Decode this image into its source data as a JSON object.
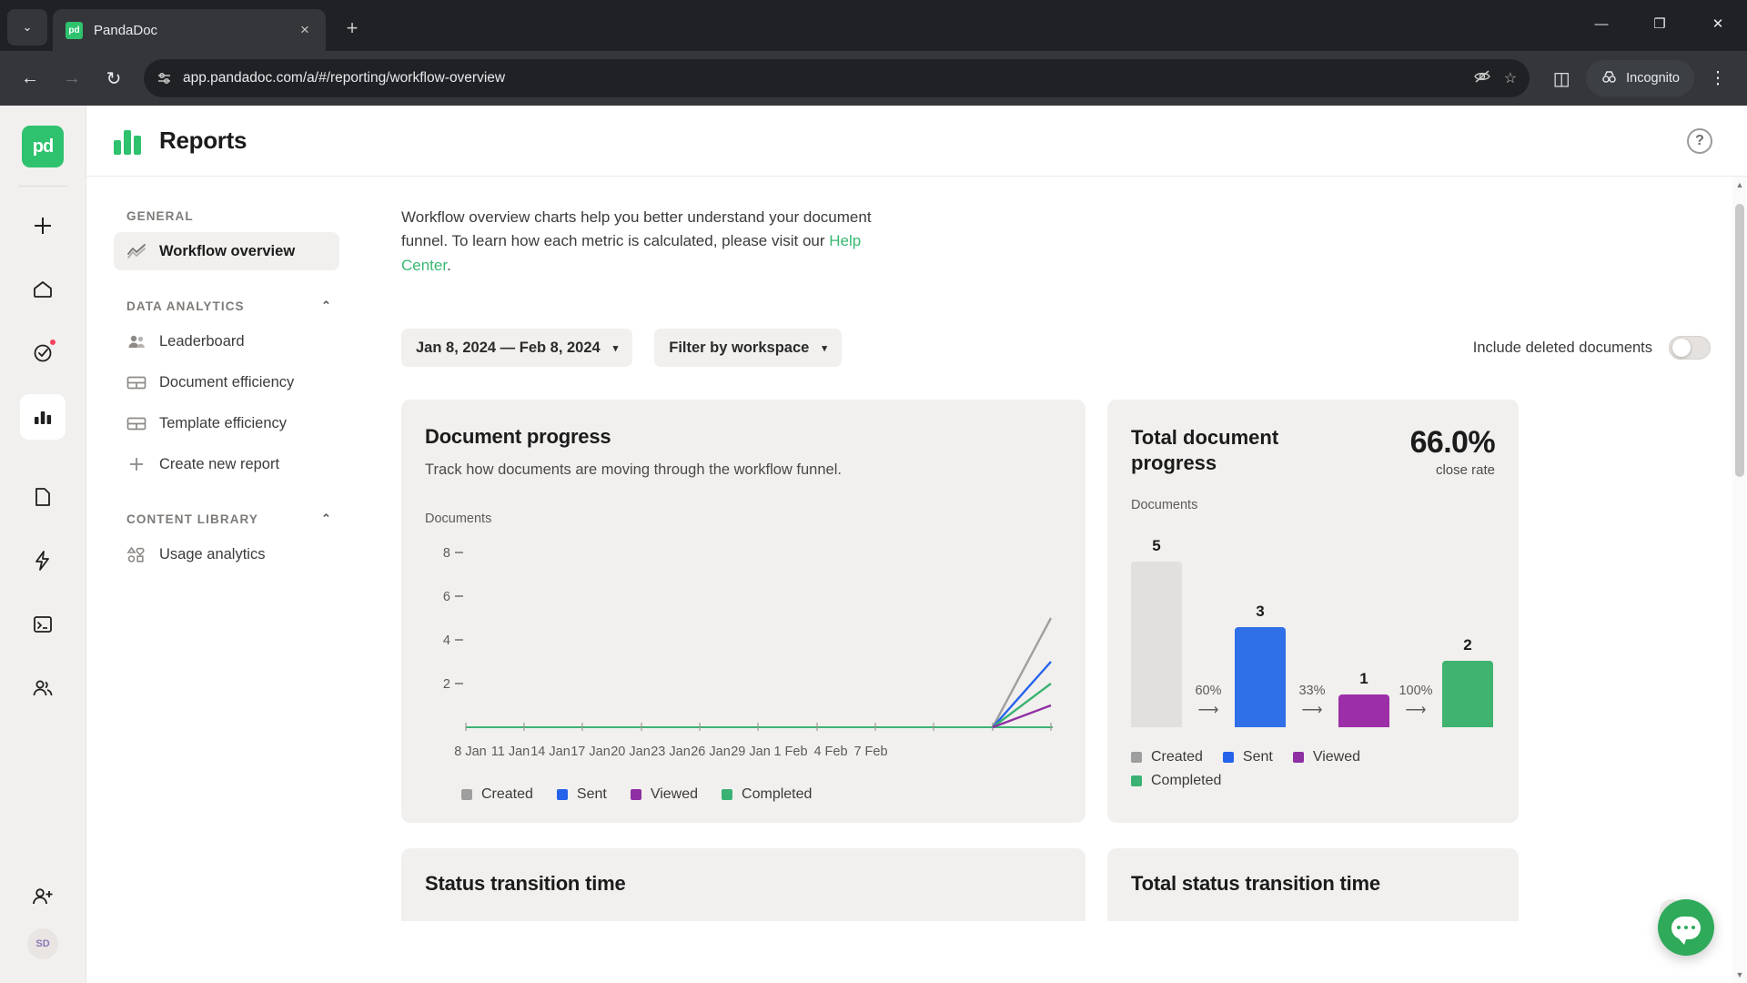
{
  "browser": {
    "tab": {
      "title": "PandaDoc",
      "favicon_text": "pd",
      "close_icon": "×"
    },
    "tab_list_icon": "⌄",
    "new_tab_icon": "+",
    "window": {
      "minimize": "—",
      "maximize": "❐",
      "close": "✕"
    },
    "nav": {
      "back": "←",
      "forward": "→",
      "reload": "↻"
    },
    "omnibox": {
      "url": "app.pandadoc.com/a/#/reporting/workflow-overview",
      "site_icon": "site-settings-icon",
      "hide_icon": "◉",
      "star_icon": "☆"
    },
    "side_panel_icon": "◫",
    "incognito_label": "Incognito",
    "menu_icon": "⋮"
  },
  "rail": {
    "logo_text": "pd",
    "items": [
      {
        "name": "create-new",
        "glyph": "+"
      },
      {
        "name": "home",
        "glyph": "home"
      },
      {
        "name": "tasks",
        "glyph": "check-circle",
        "badge": true
      },
      {
        "name": "reports",
        "glyph": "bar-chart",
        "active": true
      },
      {
        "name": "documents",
        "glyph": "document"
      },
      {
        "name": "automations",
        "glyph": "lightning"
      },
      {
        "name": "forms",
        "glyph": "terminal"
      },
      {
        "name": "contacts",
        "glyph": "people"
      },
      {
        "name": "invite-user",
        "glyph": "person-plus"
      }
    ],
    "avatar_initials": "SD"
  },
  "header": {
    "title": "Reports",
    "help_icon": "?"
  },
  "sidebar": {
    "sections": [
      {
        "caption": "GENERAL",
        "collapsible": false,
        "items": [
          {
            "label": "Workflow overview",
            "icon": "trend-lines-icon",
            "active": true
          }
        ]
      },
      {
        "caption": "DATA ANALYTICS",
        "collapsible": true,
        "chevron": "⌃",
        "items": [
          {
            "label": "Leaderboard",
            "icon": "people-icon",
            "active": false
          },
          {
            "label": "Document efficiency",
            "icon": "table-icon",
            "active": false
          },
          {
            "label": "Template efficiency",
            "icon": "table-icon",
            "active": false
          },
          {
            "label": "Create new report",
            "icon": "plus-icon",
            "active": false
          }
        ]
      },
      {
        "caption": "CONTENT LIBRARY",
        "collapsible": true,
        "chevron": "⌃",
        "items": [
          {
            "label": "Usage analytics",
            "icon": "shapes-icon",
            "active": false
          }
        ]
      }
    ]
  },
  "main": {
    "intro_part1": "Workflow overview charts help you better understand your document funnel. To learn how each metric is calculated, please visit our ",
    "intro_link": "Help Center",
    "intro_part2": ".",
    "filters": {
      "date_range": "Jan 8, 2024 — Feb 8, 2024",
      "workspace": "Filter by workspace",
      "caret": "▾",
      "include_deleted_label": "Include deleted documents",
      "include_deleted_on": false
    },
    "document_progress": {
      "title": "Document progress",
      "subtitle": "Track how documents are moving through the workflow funnel."
    },
    "total_document_progress": {
      "title": "Total document progress",
      "percent": "66.0%",
      "percent_caption": "close rate",
      "axis_label": "Documents"
    },
    "bottom_cards": [
      {
        "title": "Status transition time"
      },
      {
        "title": "Total status transition time"
      }
    ]
  },
  "chart_data": [
    {
      "id": "document-progress-line",
      "type": "line",
      "title": "Document progress",
      "subtitle": "Track how documents are moving through the workflow funnel.",
      "ylabel": "Documents",
      "xlabel": "",
      "ylim": [
        0,
        9
      ],
      "yticks": [
        2,
        4,
        6,
        8
      ],
      "grid": false,
      "legend_position": "bottom",
      "x": [
        "8 Jan",
        "11 Jan",
        "14 Jan",
        "17 Jan",
        "20 Jan",
        "23 Jan",
        "26 Jan",
        "29 Jan",
        "1 Feb",
        "4 Feb",
        "7 Feb"
      ],
      "series": [
        {
          "name": "Created",
          "color": "#9e9e9e",
          "values": [
            0,
            0,
            0,
            0,
            0,
            0,
            0,
            0,
            0,
            0,
            5
          ]
        },
        {
          "name": "Sent",
          "color": "#2563eb",
          "values": [
            0,
            0,
            0,
            0,
            0,
            0,
            0,
            0,
            0,
            0,
            3
          ]
        },
        {
          "name": "Viewed",
          "color": "#8e2fa3",
          "values": [
            0,
            0,
            0,
            0,
            0,
            0,
            0,
            0,
            0,
            0,
            1
          ]
        },
        {
          "name": "Completed",
          "color": "#3bb273",
          "values": [
            0,
            0,
            0,
            0,
            0,
            0,
            0,
            0,
            0,
            0,
            2
          ]
        }
      ]
    },
    {
      "id": "total-document-progress-funnel",
      "type": "bar",
      "title": "Total document progress",
      "ylabel": "Documents",
      "close_rate": "66.0%",
      "close_rate_caption": "close rate",
      "ylim": [
        0,
        5
      ],
      "grid": false,
      "legend_position": "bottom",
      "categories": [
        "Created",
        "Sent",
        "Viewed",
        "Completed"
      ],
      "values": [
        5,
        3,
        1,
        2
      ],
      "colors": [
        "#e2e0de",
        "#2f6fe8",
        "#9c2fa8",
        "#3fb36f"
      ],
      "conversions": [
        "60%",
        "33%",
        "100%"
      ],
      "conversion_arrow": "⟶"
    }
  ],
  "legend": {
    "items": [
      {
        "label": "Created",
        "color": "#9e9e9e"
      },
      {
        "label": "Sent",
        "color": "#2563eb"
      },
      {
        "label": "Viewed",
        "color": "#8e2fa3"
      },
      {
        "label": "Completed",
        "color": "#3bb273"
      }
    ]
  },
  "chat": {
    "close_icon": "✕",
    "bubble_icon": "chat-bubble-icon"
  },
  "scrollbar": {
    "up_icon": "▲",
    "down_icon": "▼"
  }
}
